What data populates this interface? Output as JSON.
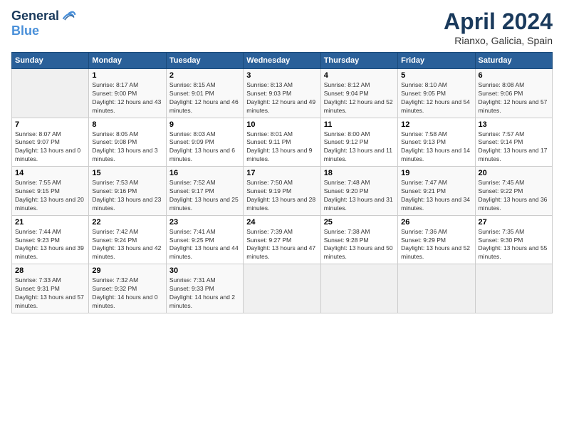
{
  "header": {
    "logo_line1": "General",
    "logo_line2": "Blue",
    "main_title": "April 2024",
    "subtitle": "Rianxo, Galicia, Spain"
  },
  "days_of_week": [
    "Sunday",
    "Monday",
    "Tuesday",
    "Wednesday",
    "Thursday",
    "Friday",
    "Saturday"
  ],
  "weeks": [
    [
      {
        "date": "",
        "sunrise": "",
        "sunset": "",
        "daylight": ""
      },
      {
        "date": "1",
        "sunrise": "Sunrise: 8:17 AM",
        "sunset": "Sunset: 9:00 PM",
        "daylight": "Daylight: 12 hours and 43 minutes."
      },
      {
        "date": "2",
        "sunrise": "Sunrise: 8:15 AM",
        "sunset": "Sunset: 9:01 PM",
        "daylight": "Daylight: 12 hours and 46 minutes."
      },
      {
        "date": "3",
        "sunrise": "Sunrise: 8:13 AM",
        "sunset": "Sunset: 9:03 PM",
        "daylight": "Daylight: 12 hours and 49 minutes."
      },
      {
        "date": "4",
        "sunrise": "Sunrise: 8:12 AM",
        "sunset": "Sunset: 9:04 PM",
        "daylight": "Daylight: 12 hours and 52 minutes."
      },
      {
        "date": "5",
        "sunrise": "Sunrise: 8:10 AM",
        "sunset": "Sunset: 9:05 PM",
        "daylight": "Daylight: 12 hours and 54 minutes."
      },
      {
        "date": "6",
        "sunrise": "Sunrise: 8:08 AM",
        "sunset": "Sunset: 9:06 PM",
        "daylight": "Daylight: 12 hours and 57 minutes."
      }
    ],
    [
      {
        "date": "7",
        "sunrise": "Sunrise: 8:07 AM",
        "sunset": "Sunset: 9:07 PM",
        "daylight": "Daylight: 13 hours and 0 minutes."
      },
      {
        "date": "8",
        "sunrise": "Sunrise: 8:05 AM",
        "sunset": "Sunset: 9:08 PM",
        "daylight": "Daylight: 13 hours and 3 minutes."
      },
      {
        "date": "9",
        "sunrise": "Sunrise: 8:03 AM",
        "sunset": "Sunset: 9:09 PM",
        "daylight": "Daylight: 13 hours and 6 minutes."
      },
      {
        "date": "10",
        "sunrise": "Sunrise: 8:01 AM",
        "sunset": "Sunset: 9:11 PM",
        "daylight": "Daylight: 13 hours and 9 minutes."
      },
      {
        "date": "11",
        "sunrise": "Sunrise: 8:00 AM",
        "sunset": "Sunset: 9:12 PM",
        "daylight": "Daylight: 13 hours and 11 minutes."
      },
      {
        "date": "12",
        "sunrise": "Sunrise: 7:58 AM",
        "sunset": "Sunset: 9:13 PM",
        "daylight": "Daylight: 13 hours and 14 minutes."
      },
      {
        "date": "13",
        "sunrise": "Sunrise: 7:57 AM",
        "sunset": "Sunset: 9:14 PM",
        "daylight": "Daylight: 13 hours and 17 minutes."
      }
    ],
    [
      {
        "date": "14",
        "sunrise": "Sunrise: 7:55 AM",
        "sunset": "Sunset: 9:15 PM",
        "daylight": "Daylight: 13 hours and 20 minutes."
      },
      {
        "date": "15",
        "sunrise": "Sunrise: 7:53 AM",
        "sunset": "Sunset: 9:16 PM",
        "daylight": "Daylight: 13 hours and 23 minutes."
      },
      {
        "date": "16",
        "sunrise": "Sunrise: 7:52 AM",
        "sunset": "Sunset: 9:17 PM",
        "daylight": "Daylight: 13 hours and 25 minutes."
      },
      {
        "date": "17",
        "sunrise": "Sunrise: 7:50 AM",
        "sunset": "Sunset: 9:19 PM",
        "daylight": "Daylight: 13 hours and 28 minutes."
      },
      {
        "date": "18",
        "sunrise": "Sunrise: 7:48 AM",
        "sunset": "Sunset: 9:20 PM",
        "daylight": "Daylight: 13 hours and 31 minutes."
      },
      {
        "date": "19",
        "sunrise": "Sunrise: 7:47 AM",
        "sunset": "Sunset: 9:21 PM",
        "daylight": "Daylight: 13 hours and 34 minutes."
      },
      {
        "date": "20",
        "sunrise": "Sunrise: 7:45 AM",
        "sunset": "Sunset: 9:22 PM",
        "daylight": "Daylight: 13 hours and 36 minutes."
      }
    ],
    [
      {
        "date": "21",
        "sunrise": "Sunrise: 7:44 AM",
        "sunset": "Sunset: 9:23 PM",
        "daylight": "Daylight: 13 hours and 39 minutes."
      },
      {
        "date": "22",
        "sunrise": "Sunrise: 7:42 AM",
        "sunset": "Sunset: 9:24 PM",
        "daylight": "Daylight: 13 hours and 42 minutes."
      },
      {
        "date": "23",
        "sunrise": "Sunrise: 7:41 AM",
        "sunset": "Sunset: 9:25 PM",
        "daylight": "Daylight: 13 hours and 44 minutes."
      },
      {
        "date": "24",
        "sunrise": "Sunrise: 7:39 AM",
        "sunset": "Sunset: 9:27 PM",
        "daylight": "Daylight: 13 hours and 47 minutes."
      },
      {
        "date": "25",
        "sunrise": "Sunrise: 7:38 AM",
        "sunset": "Sunset: 9:28 PM",
        "daylight": "Daylight: 13 hours and 50 minutes."
      },
      {
        "date": "26",
        "sunrise": "Sunrise: 7:36 AM",
        "sunset": "Sunset: 9:29 PM",
        "daylight": "Daylight: 13 hours and 52 minutes."
      },
      {
        "date": "27",
        "sunrise": "Sunrise: 7:35 AM",
        "sunset": "Sunset: 9:30 PM",
        "daylight": "Daylight: 13 hours and 55 minutes."
      }
    ],
    [
      {
        "date": "28",
        "sunrise": "Sunrise: 7:33 AM",
        "sunset": "Sunset: 9:31 PM",
        "daylight": "Daylight: 13 hours and 57 minutes."
      },
      {
        "date": "29",
        "sunrise": "Sunrise: 7:32 AM",
        "sunset": "Sunset: 9:32 PM",
        "daylight": "Daylight: 14 hours and 0 minutes."
      },
      {
        "date": "30",
        "sunrise": "Sunrise: 7:31 AM",
        "sunset": "Sunset: 9:33 PM",
        "daylight": "Daylight: 14 hours and 2 minutes."
      },
      {
        "date": "",
        "sunrise": "",
        "sunset": "",
        "daylight": ""
      },
      {
        "date": "",
        "sunrise": "",
        "sunset": "",
        "daylight": ""
      },
      {
        "date": "",
        "sunrise": "",
        "sunset": "",
        "daylight": ""
      },
      {
        "date": "",
        "sunrise": "",
        "sunset": "",
        "daylight": ""
      }
    ]
  ]
}
